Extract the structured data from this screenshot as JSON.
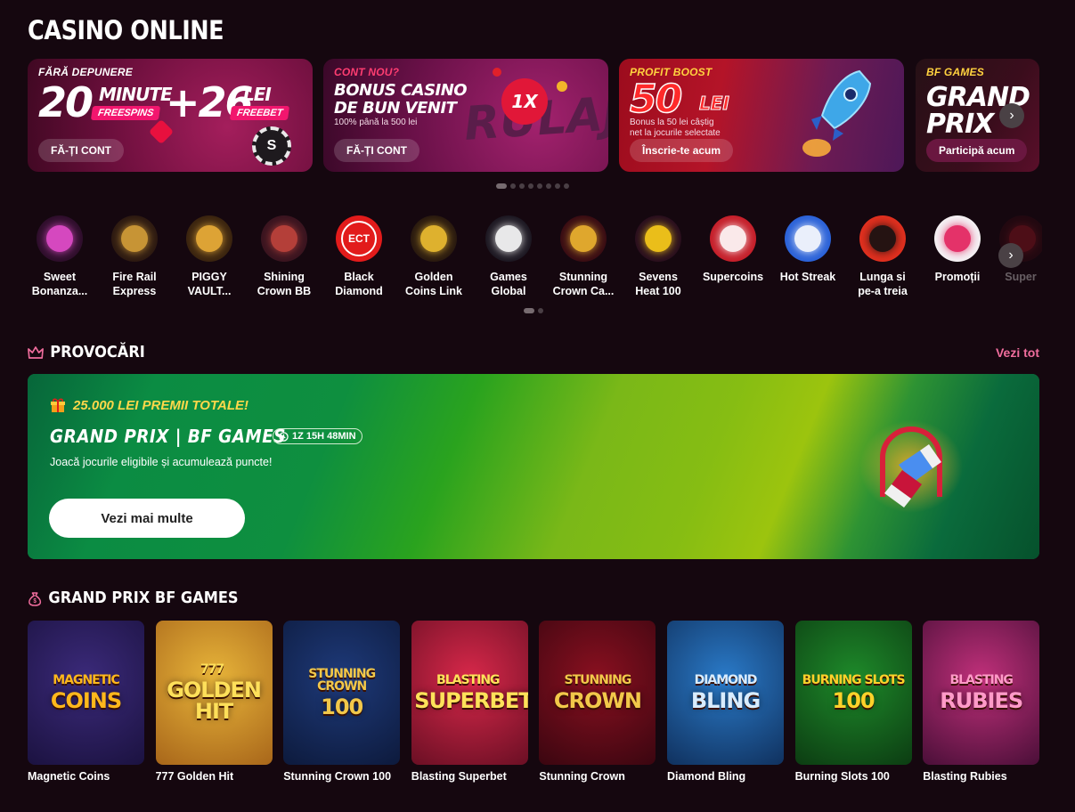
{
  "page": {
    "title": "CASINO ONLINE"
  },
  "banners": [
    {
      "tag": "FĂRĂ DEPUNERE",
      "headline_a": "20",
      "pill_a_top": "MINUTE",
      "pill_a": "FREESPINS",
      "headline_b": "+26",
      "pill_b_top": "LEI",
      "pill_b": "FREEBET",
      "button": "FĂ-ȚI CONT",
      "tag_color": "#ffffff"
    },
    {
      "tag": "CONT NOU?",
      "headline": "BONUS CASINO",
      "headline2": "DE BUN VENIT",
      "sub": "100% până la 500 lei",
      "art_text": "RULAJ",
      "badge": "1X",
      "button": "FĂ-ȚI CONT",
      "tag_color": "#ff3d71"
    },
    {
      "tag": "PROFIT BOOST",
      "headline": "50",
      "unit": "LEI",
      "sub1": "Bonus la 50 lei câștig",
      "sub2": "net la jocurile selectate",
      "button": "Înscrie-te acum",
      "tag_color": "#ffd23f"
    },
    {
      "tag": "BF GAMES",
      "headline": "GRAND",
      "headline2": "PRIX",
      "button": "Participă acum",
      "tag_color": "#ffd23f"
    }
  ],
  "banner_dots": 8,
  "categories": [
    {
      "label1": "Sweet",
      "label2": "Bonanza...",
      "icon": "candy-icon",
      "bg": "#2e0f2b",
      "fg": "#e84fd0"
    },
    {
      "label1": "Fire Rail",
      "label2": "Express",
      "icon": "train-icon",
      "bg": "#2d1a12",
      "fg": "#d9a23a"
    },
    {
      "label1": "PIGGY",
      "label2": "VAULT...",
      "icon": "piggy-icon",
      "bg": "#3a2410",
      "fg": "#f0b23a"
    },
    {
      "label1": "Shining",
      "label2": "Crown BB",
      "icon": "chest-icon",
      "bg": "#3a1520",
      "fg": "#c2443c"
    },
    {
      "label1": "Black",
      "label2": "Diamond",
      "icon": "ect-logo-icon",
      "bg": "#e21b1b",
      "fg": "#ffffff",
      "text": "ECT"
    },
    {
      "label1": "Golden",
      "label2": "Coins Link",
      "icon": "golden-coins-icon",
      "bg": "#2a1a10",
      "fg": "#f2c232"
    },
    {
      "label1": "Games",
      "label2": "Global",
      "icon": "games-global-icon",
      "bg": "#1d1822",
      "fg": "#ffffff"
    },
    {
      "label1": "Stunning",
      "label2": "Crown Ca...",
      "icon": "crown-icon",
      "bg": "#3a0d14",
      "fg": "#f2b830"
    },
    {
      "label1": "Sevens",
      "label2": "Heat 100",
      "icon": "duck-icon",
      "bg": "#2a0f1e",
      "fg": "#ffd21a"
    },
    {
      "label1": "Supercoins",
      "label2": "",
      "icon": "supercoins-icon",
      "bg": "#c51f2a",
      "fg": "#ffffff"
    },
    {
      "label1": "Hot Streak",
      "label2": "",
      "icon": "hot-streak-icon",
      "bg": "#2b62d8",
      "fg": "#ffffff"
    },
    {
      "label1": "Lunga si",
      "label2": "pe-a treia",
      "icon": "lunga-icon",
      "bg": "#e0301f",
      "fg": "#111111"
    },
    {
      "label1": "Promoții",
      "label2": "",
      "icon": "gift-icon",
      "bg": "#f4f1f4",
      "fg": "#e31d5a"
    },
    {
      "label1": "Super",
      "label2": "",
      "icon": "super-icon",
      "bg": "#3a0d14",
      "fg": "#c51f2a"
    }
  ],
  "challenges": {
    "section_title": "PROVOCĂRI",
    "see_all": "Vezi tot",
    "prize": "25.000 LEI PREMII TOTALE!",
    "title": "GRAND PRIX | BF GAMES",
    "timer": "1Z 15H 48MIN",
    "description": "Joacă jocurile eligibile și acumulează puncte!",
    "button": "Vezi mai multe"
  },
  "games_section": {
    "title": "GRAND PRIX BF GAMES",
    "games": [
      {
        "name": "Magnetic Coins",
        "logo1": "MAGNETIC",
        "logo2": "COINS",
        "bg1": "#3b2a7a",
        "bg2": "#1b1240",
        "c": "#ffb81c"
      },
      {
        "name": "777 Golden Hit",
        "logo1": "777",
        "logo2": "GOLDEN HIT",
        "bg1": "#e8b53a",
        "bg2": "#a8661a",
        "c": "#ffe05a"
      },
      {
        "name": "Stunning Crown 100",
        "logo1": "STUNNING CROWN",
        "logo2": "100",
        "bg1": "#1e3a7a",
        "bg2": "#0d1a3c",
        "c": "#f2c84a"
      },
      {
        "name": "Blasting Superbet",
        "logo1": "BLASTING",
        "logo2": "SUPERBET",
        "bg1": "#d8284a",
        "bg2": "#6a0f24",
        "c": "#ffe25a"
      },
      {
        "name": "Stunning Crown",
        "logo1": "STUNNING",
        "logo2": "CROWN",
        "bg1": "#8a1020",
        "bg2": "#3a0610",
        "c": "#f2c84a"
      },
      {
        "name": "Diamond Bling",
        "logo1": "DIAMOND",
        "logo2": "BLING",
        "bg1": "#2a7ac8",
        "bg2": "#10315e",
        "c": "#d8ecff"
      },
      {
        "name": "Burning Slots 100",
        "logo1": "BURNING SLOTS",
        "logo2": "100",
        "bg1": "#1e8a2a",
        "bg2": "#0c3c12",
        "c": "#ffd22a"
      },
      {
        "name": "Blasting Rubies",
        "logo1": "BLASTING",
        "logo2": "RUBIES",
        "bg1": "#c0307a",
        "bg2": "#4a0f38",
        "c": "#ff9ac8"
      }
    ]
  }
}
